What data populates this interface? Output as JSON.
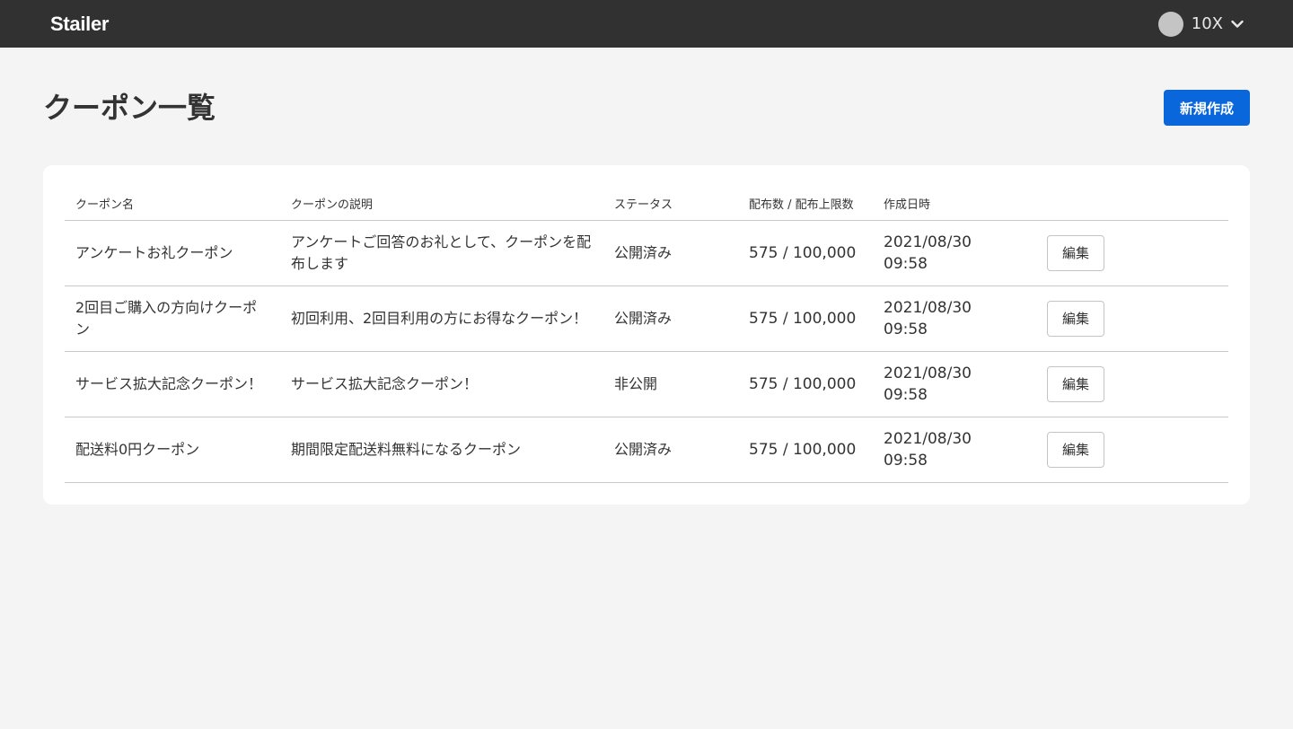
{
  "header": {
    "logo": "Stailer",
    "account_name": "10X"
  },
  "page": {
    "title": "クーポン一覧",
    "create_label": "新規作成"
  },
  "table": {
    "columns": [
      "クーポン名",
      "クーポンの説明",
      "ステータス",
      "配布数 / 配布上限数",
      "作成日時",
      ""
    ],
    "rows": [
      {
        "name": "アンケートお礼クーポン",
        "description": "アンケートご回答のお礼として、クーポンを配布します",
        "status": "公開済み",
        "distribution": "575 / 100,000",
        "created": "2021/08/30 09:58",
        "action": "編集"
      },
      {
        "name": "2回目ご購入の方向けクーポン",
        "description": "初回利用、2回目利用の方にお得なクーポン！",
        "status": "公開済み",
        "distribution": "575 / 100,000",
        "created": "2021/08/30 09:58",
        "action": "編集"
      },
      {
        "name": "サービス拡大記念クーポン！",
        "description": "サービス拡大記念クーポン！",
        "status": "非公開",
        "distribution": "575 / 100,000",
        "created": "2021/08/30 09:58",
        "action": "編集"
      },
      {
        "name": "配送料0円クーポン",
        "description": "期間限定配送料無料になるクーポン",
        "status": "公開済み",
        "distribution": "575 / 100,000",
        "created": "2021/08/30 09:58",
        "action": "編集"
      }
    ]
  },
  "colors": {
    "topbar": "#313131",
    "primary_button": "#0a66db",
    "background": "#f4f4f4"
  },
  "icons": {
    "avatar": "avatar-circle",
    "dropdown": "chevron-down-icon"
  }
}
